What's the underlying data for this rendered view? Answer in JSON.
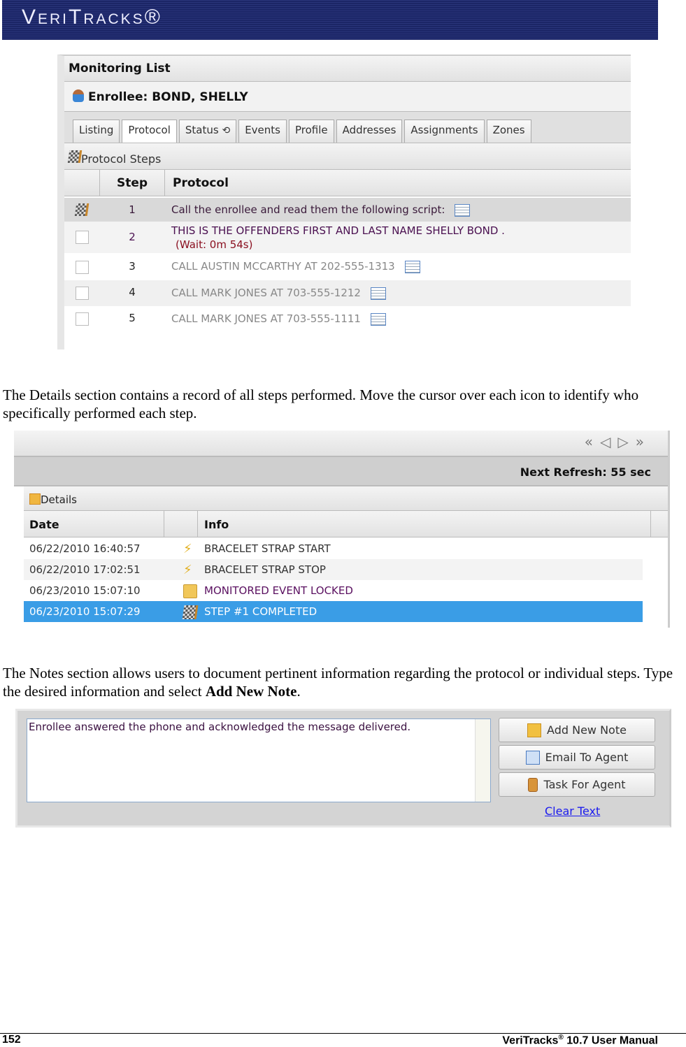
{
  "banner": {
    "brand": "VeriTracks®"
  },
  "shot1": {
    "title": "Monitoring List",
    "enrollee": "Enrollee: BOND, SHELLY",
    "tabs": [
      "Listing",
      "Protocol",
      "Status",
      "Events",
      "Profile",
      "Addresses",
      "Assignments",
      "Zones"
    ],
    "active_tab": "Protocol",
    "section": "Protocol Steps",
    "columns": {
      "step": "Step",
      "protocol": "Protocol"
    },
    "rows": [
      {
        "step": "1",
        "text": "Call the enrollee and read them the following script:",
        "completed": true
      },
      {
        "step": "2",
        "text": "THIS IS THE OFFENDERS FIRST AND LAST NAME SHELLY BOND .",
        "wait": "(Wait: 0m 54s)"
      },
      {
        "step": "3",
        "text": "CALL AUSTIN MCCARTHY AT 202-555-1313"
      },
      {
        "step": "4",
        "text": "CALL MARK JONES AT 703-555-1212"
      },
      {
        "step": "5",
        "text": "CALL MARK JONES AT 703-555-1111"
      }
    ]
  },
  "para1": "The Details section contains a record of all steps performed.  Move the cursor over each icon to identify who specifically performed each step.",
  "shot2": {
    "refresh": "Next Refresh: 55 sec",
    "section": "Details",
    "columns": {
      "date": "Date",
      "info": "Info"
    },
    "rows": [
      {
        "date": "06/22/2010 16:40:57",
        "icon": "bolt-plus-icon",
        "info": "BRACELET STRAP START"
      },
      {
        "date": "06/22/2010 17:02:51",
        "icon": "bolt-minus-icon",
        "info": "BRACELET STRAP STOP"
      },
      {
        "date": "06/23/2010 15:07:10",
        "icon": "lock-icon",
        "info": "MONITORED EVENT LOCKED"
      },
      {
        "date": "06/23/2010 15:07:29",
        "icon": "flag-icon",
        "info": "STEP #1 COMPLETED",
        "selected": true
      }
    ],
    "selected_color": "#3a9de6"
  },
  "para2": {
    "text1": "The Notes section allows users to document pertinent information regarding the protocol or individual steps.  Type the desired information and select ",
    "bold": "Add New Note",
    "text2": "."
  },
  "shot3": {
    "note": "Enrollee answered the phone and acknowledged the message delivered.",
    "buttons": [
      "Add New Note",
      "Email To Agent",
      "Task For Agent"
    ],
    "clear": "Clear Text"
  },
  "footer": {
    "page": "152",
    "manual": "VeriTracks",
    "reg": "®",
    "version": " 10.7 User Manual"
  }
}
